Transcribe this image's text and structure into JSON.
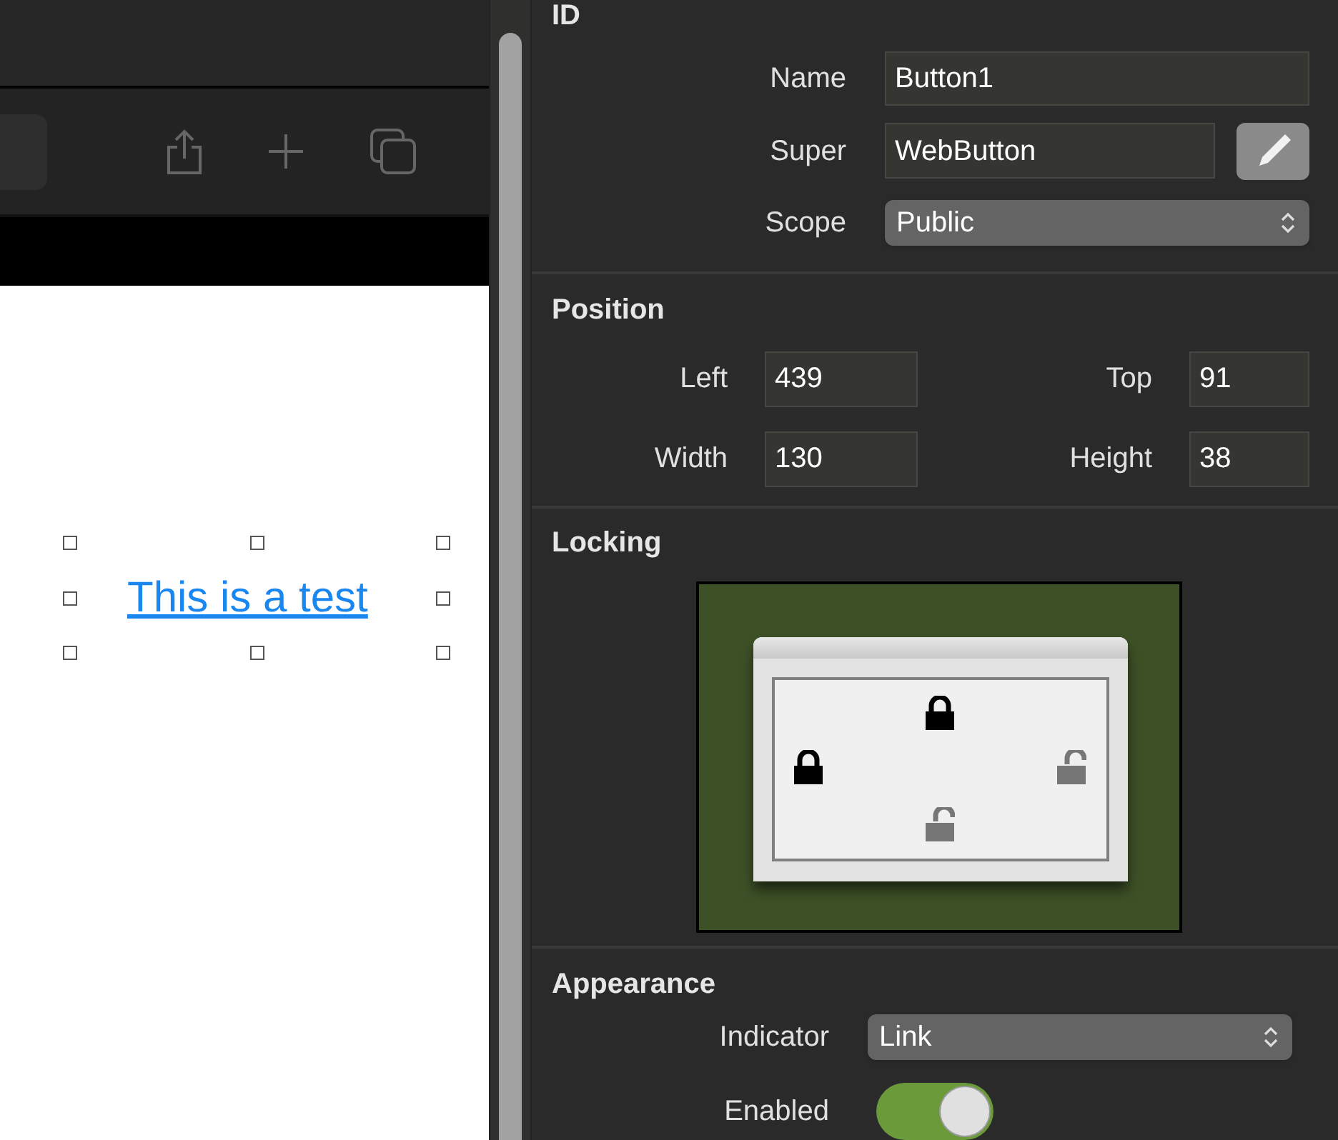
{
  "canvas": {
    "link_text": "This is a test",
    "selected": true
  },
  "inspector": {
    "id_section": {
      "title": "ID",
      "name_label": "Name",
      "name_value": "Button1",
      "super_label": "Super",
      "super_value": "WebButton",
      "scope_label": "Scope",
      "scope_value": "Public"
    },
    "position": {
      "title": "Position",
      "left_label": "Left",
      "left_value": "439",
      "top_label": "Top",
      "top_value": "91",
      "width_label": "Width",
      "width_value": "130",
      "height_label": "Height",
      "height_value": "38"
    },
    "locking": {
      "title": "Locking",
      "top_locked": true,
      "left_locked": true,
      "right_locked": false,
      "bottom_locked": false
    },
    "appearance": {
      "title": "Appearance",
      "indicator_label": "Indicator",
      "indicator_value": "Link",
      "enabled_label": "Enabled",
      "enabled_on": true
    }
  }
}
